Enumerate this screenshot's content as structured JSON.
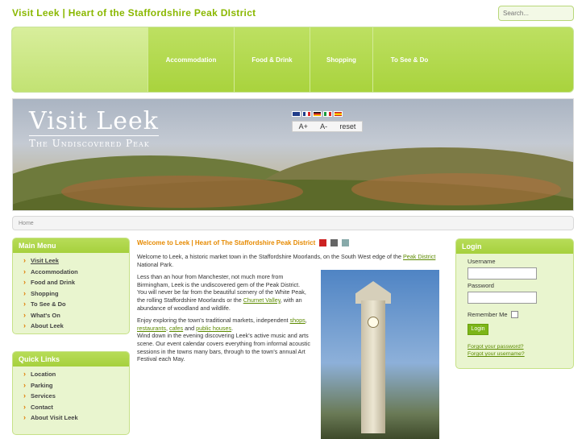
{
  "site": {
    "title": "Visit Leek | Heart of the Staffordshire Peak DIstrict"
  },
  "search": {
    "placeholder": "Search..."
  },
  "nav": {
    "items": [
      "Accommodation",
      "Food & Drink",
      "Shopping",
      "To See & Do"
    ]
  },
  "banner": {
    "brand_main": "Visit Leek",
    "brand_sub": "The Undiscovered Peak",
    "font_tools": [
      "A+",
      "A-",
      "reset"
    ]
  },
  "breadcrumb": {
    "label": "Home"
  },
  "main_menu": {
    "title": "Main Menu",
    "items": [
      "Visit Leek",
      "Accommodation",
      "Food and Drink",
      "Shopping",
      "To See & Do",
      "What's On",
      "About Leek"
    ]
  },
  "quick_links": {
    "title": "Quick Links",
    "items": [
      "Location",
      "Parking",
      "Services",
      "Contact",
      "About Visit Leek"
    ]
  },
  "content": {
    "title": "Welcome to Leek | Heart of The Staffordshire Peak District",
    "p1_a": "Welcome to Leek, a historic market town in the Staffordshire Moorlands, on the South West edge of the ",
    "p1_link": "Peak District",
    "p1_b": " National Park.",
    "p2": "Less than an hour from Manchester, not much more from Birmingham, Leek is the undiscovered gem of the Peak District.",
    "p3_a": "You will never be far from the beautiful scenery of the White Peak, the rolling Staffordshire Moorlands or the ",
    "p3_link": "Churnet Valley",
    "p3_b": ", with an abundance of woodland and wildlife.",
    "p4_a": "Enjoy exploring the town's traditional markets, independent ",
    "p4_l1": "shops",
    "p4_l2": "restaurants",
    "p4_l3": "cafes",
    "p4_and": " and ",
    "p4_l4": "public houses",
    "p4_end": ".",
    "p5": "Wind down in the evening discovering Leek's active music and arts scene. Our event calendar covers everything from informal acoustic sessions in the towns many bars, through to the town's annual Art Festival each May."
  },
  "login": {
    "title": "Login",
    "username_label": "Username",
    "password_label": "Password",
    "remember_label": "Remember Me",
    "button": "Login",
    "forgot_password": "Forgot your password?",
    "forgot_username": "Forgot your username?"
  },
  "colors": {
    "accent": "#8ab800",
    "nav": "#a9d33d",
    "panel_bg": "#e9f5cf",
    "title_orange": "#e68a00"
  }
}
